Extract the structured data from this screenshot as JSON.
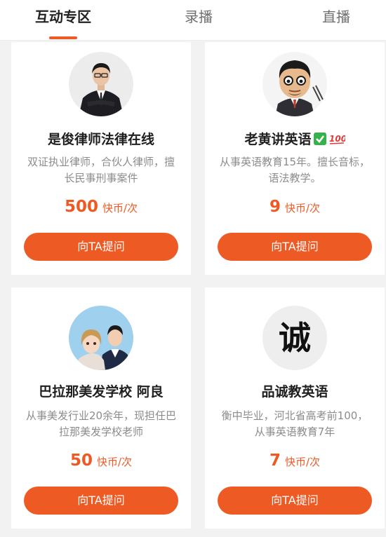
{
  "tabs": [
    {
      "label": "互动专区",
      "active": true
    },
    {
      "label": "录播",
      "active": false
    },
    {
      "label": "直播",
      "active": false
    }
  ],
  "colors": {
    "accent": "#ee5a24",
    "background": "#f2f2f2",
    "card": "#ffffff"
  },
  "experts": [
    {
      "name": "是俊律师法律在线",
      "desc": "双证执业律师，合伙人律师，擅长民事刑事案件",
      "price": "500",
      "unit": "快币/次",
      "button": "向TA提问",
      "avatar": "lawyer-portrait"
    },
    {
      "name": "老黄讲英语",
      "name_emoji": [
        "check-mark-icon",
        "hundred-points-icon"
      ],
      "desc": "从事英语教育15年。擅长音标，语法教学。",
      "price": "9",
      "unit": "快币/次",
      "button": "向TA提问",
      "avatar": "cartoon-teacher"
    },
    {
      "name": "巴拉那美发学校 阿良",
      "desc": "从事美发行业20余年，现担任巴拉那美发学校老师",
      "price": "50",
      "unit": "快币/次",
      "button": "向TA提问",
      "avatar": "couple-photo"
    },
    {
      "name": "品诚教英语",
      "desc": "衡中毕业，河北省高考前100，从事英语教育7年",
      "price": "7",
      "unit": "快币/次",
      "button": "向TA提问",
      "avatar": "calligraphy",
      "avatar_text": "诚"
    }
  ]
}
